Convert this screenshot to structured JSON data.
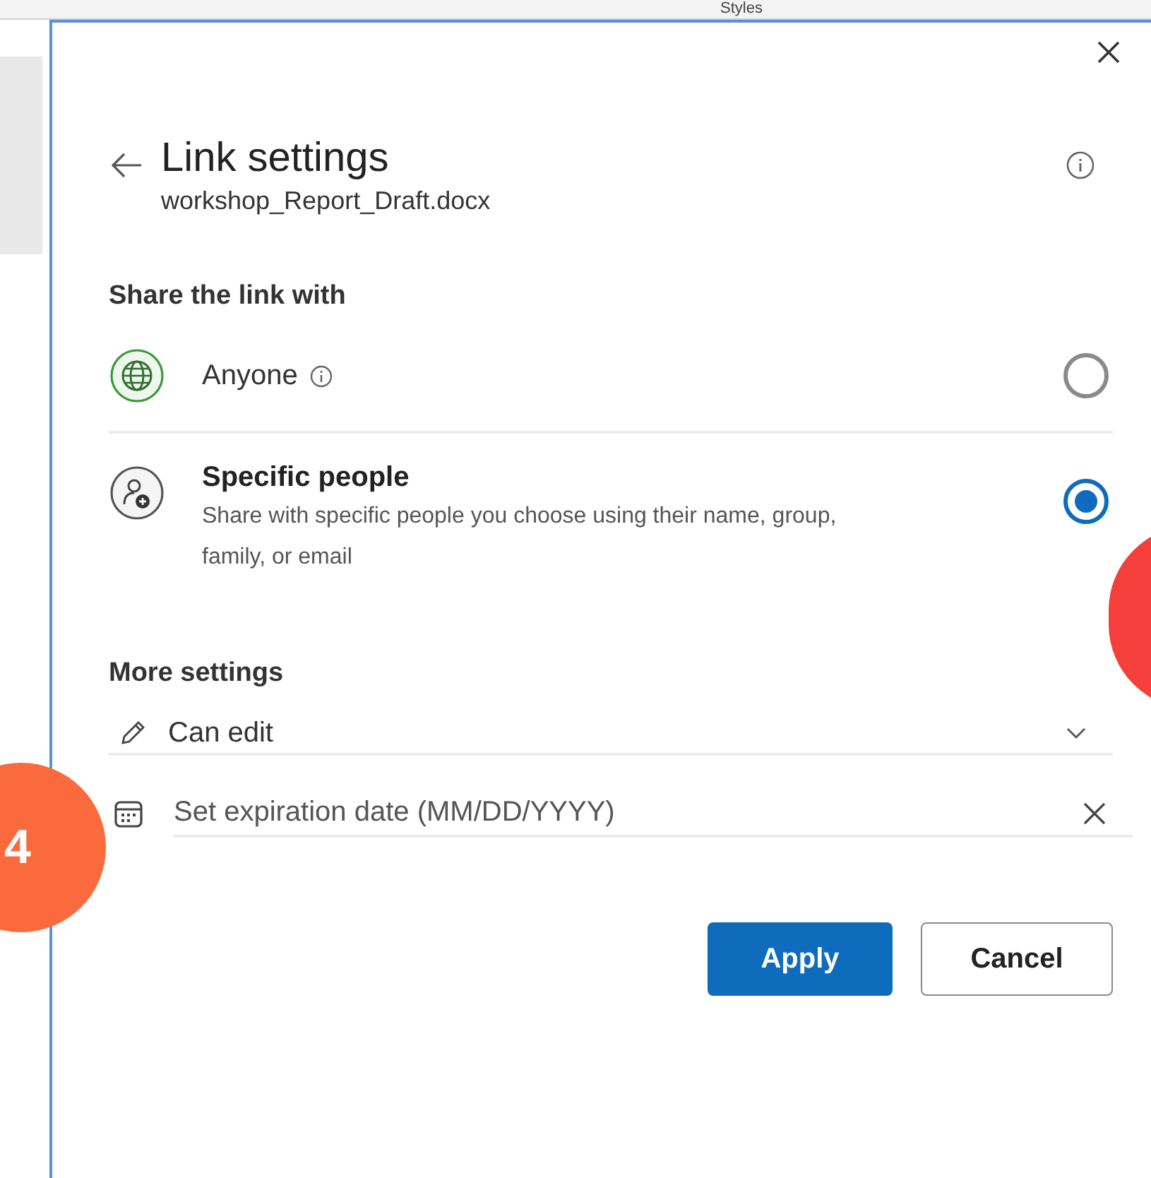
{
  "background": {
    "ribbon_label": "Styles"
  },
  "dialog": {
    "title": "Link settings",
    "filename": "workshop_Report_Draft.docx",
    "share_heading": "Share the link with",
    "options": [
      {
        "kind": "globe",
        "label": "Anyone",
        "info": true,
        "selected": false
      },
      {
        "kind": "people",
        "label": "Specific people",
        "description": "Share with specific people you choose using their name, group, family, or email",
        "info": false,
        "selected": true
      }
    ],
    "more_heading": "More settings",
    "permission": {
      "value": "Can edit"
    },
    "expiration": {
      "placeholder": "Set expiration date (MM/DD/YYYY)"
    },
    "buttons": [
      {
        "kind": "primary",
        "label": "Apply"
      },
      {
        "kind": "secondary",
        "label": "Cancel"
      }
    ]
  },
  "callouts": [
    {
      "label": "4",
      "color": "#fb6a3c"
    },
    {
      "color": "#f43f3a"
    }
  ]
}
